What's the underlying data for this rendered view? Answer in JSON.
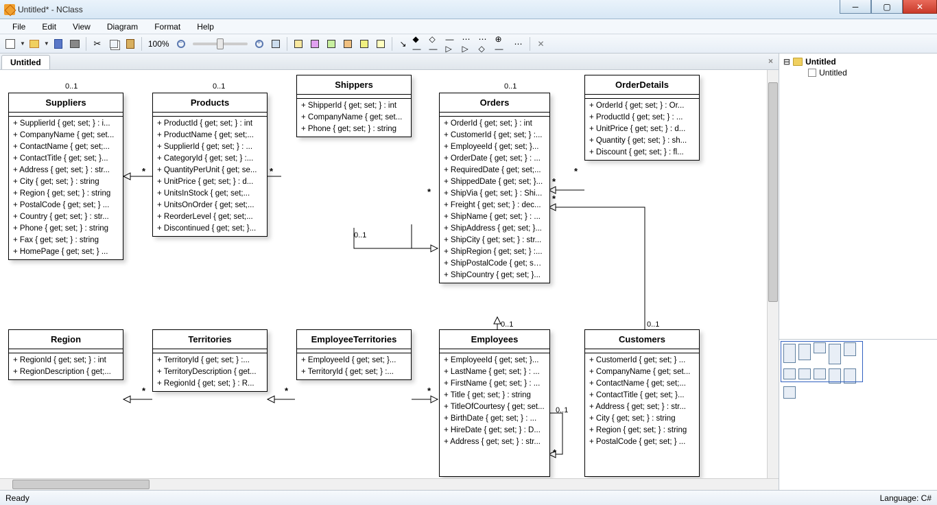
{
  "window": {
    "title": "Untitled* - NClass"
  },
  "menu": [
    "File",
    "Edit",
    "View",
    "Diagram",
    "Format",
    "Help"
  ],
  "toolbar": {
    "zoom": "100%"
  },
  "tab": {
    "title": "Untitled",
    "close": "×"
  },
  "tree": {
    "root": "Untitled",
    "child": "Untitled"
  },
  "status": {
    "left": "Ready",
    "right": "Language: C#"
  },
  "canvas_scrollbar": {
    "v_shown": true
  },
  "cards": {
    "suppliers": {
      "name": "Suppliers",
      "mult": "0..1",
      "members": [
        "+ SupplierId { get; set; } : i...",
        "+ CompanyName { get; set...",
        "+ ContactName { get; set;...",
        "+ ContactTitle { get; set; }...",
        "+ Address { get; set; } : str...",
        "+ City { get; set; } : string",
        "+ Region { get; set; } : string",
        "+ PostalCode { get; set; } ...",
        "+ Country { get; set; } : str...",
        "+ Phone { get; set; } : string",
        "+ Fax { get; set; } : string",
        "+ HomePage { get; set; } ..."
      ]
    },
    "products": {
      "name": "Products",
      "mult": "0..1",
      "members": [
        "+ ProductId { get; set; } : int",
        "+ ProductName { get; set;...",
        "+ SupplierId { get; set; } : ...",
        "+ CategoryId { get; set; } :...",
        "+ QuantityPerUnit { get; se...",
        "+ UnitPrice { get; set; } : d...",
        "+ UnitsInStock { get; set;...",
        "+ UnitsOnOrder { get; set;...",
        "+ ReorderLevel { get; set;...",
        "+ Discontinued { get; set; }..."
      ]
    },
    "shippers": {
      "name": "Shippers",
      "members": [
        "+ ShipperId { get; set; } : int",
        "+ CompanyName { get; set...",
        "+ Phone { get; set; } : string"
      ]
    },
    "orders": {
      "name": "Orders",
      "mult": "0..1",
      "members": [
        "+ OrderId { get; set; } : int",
        "+ CustomerId { get; set; } :...",
        "+ EmployeeId { get; set; }...",
        "+ OrderDate { get; set; } : ...",
        "+ RequiredDate { get; set;...",
        "+ ShippedDate { get; set; }...",
        "+ ShipVia { get; set; } : Shi...",
        "+ Freight { get; set; } : dec...",
        "+ ShipName { get; set; } : ...",
        "+ ShipAddress { get; set; }...",
        "+ ShipCity { get; set; } : str...",
        "+ ShipRegion { get; set; } :...",
        "+ ShipPostalCode { get; set...",
        "+ ShipCountry { get; set; }..."
      ]
    },
    "orderdetails": {
      "name": "OrderDetails",
      "members": [
        "+ OrderId { get; set; } : Or...",
        "+ ProductId { get; set; } : ...",
        "+ UnitPrice { get; set; } : d...",
        "+ Quantity { get; set; } : sh...",
        "+ Discount { get; set; } : fl..."
      ]
    },
    "region": {
      "name": "Region",
      "members": [
        "+ RegionId { get; set; } : int",
        "+ RegionDescription { get;..."
      ]
    },
    "territories": {
      "name": "Territories",
      "members": [
        "+ TerritoryId { get; set; } :...",
        "+ TerritoryDescription { get...",
        "+ RegionId { get; set; } : R..."
      ]
    },
    "employeeterritories": {
      "name": "EmployeeTerritories",
      "members": [
        "+ EmployeeId { get; set; }...",
        "+ TerritoryId { get; set; } :..."
      ]
    },
    "employees": {
      "name": "Employees",
      "mult": "0..1",
      "members": [
        "+ EmployeeId { get; set; }...",
        "+ LastName { get; set; } : ...",
        "+ FirstName { get; set; } : ...",
        "+ Title { get; set; } : string",
        "+ TitleOfCourtesy { get; set...",
        "+ BirthDate { get; set; } : ...",
        "+ HireDate { get; set; } : D...",
        "+ Address { get; set; } : str..."
      ]
    },
    "customers": {
      "name": "Customers",
      "mult": "0..1",
      "members": [
        "+ CustomerId { get; set; } ...",
        "+ CompanyName { get; set...",
        "+ ContactName { get; set;...",
        "+ ContactTitle { get; set; }...",
        "+ Address { get; set; } : str...",
        "+ City { get; set; } : string",
        "+ Region { get; set; } : string",
        "+ PostalCode { get; set; } ..."
      ]
    }
  },
  "labels": {
    "zero_one_shippers": "0..1",
    "zero_one_employees": "0..1",
    "zero_one_customers": "0..1",
    "zero_one_emp_self": "0..1",
    "star": "*"
  }
}
